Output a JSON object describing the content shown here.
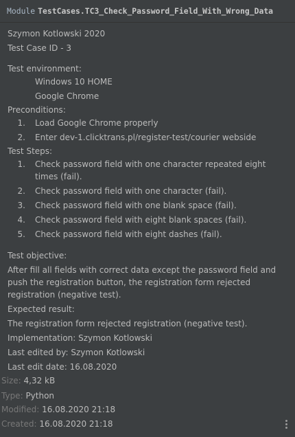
{
  "header": {
    "keyword": "Module",
    "module_name": "TestCases.TC3_Check_Password_Field_With_Wrong_Data"
  },
  "doc": {
    "author_line": "Szymon Kotlowski 2020",
    "test_case_id": "Test Case ID - 3",
    "env_heading": "Test environment:",
    "env_items": [
      "Windows 10 HOME",
      "Google Chrome"
    ],
    "pre_heading": "Preconditions:",
    "pre_items": [
      {
        "num": "1.",
        "text": "Load Google Chrome properly"
      },
      {
        "num": "2.",
        "text": "Enter dev-1.clicktrans.pl/register-test/courier webside"
      }
    ],
    "steps_heading": "Test Steps:",
    "steps": [
      {
        "num": "1.",
        "text": "Check password field with one character repeated eight",
        "text2": "times (fail)."
      },
      {
        "num": "2.",
        "text": "Check password field with one character (fail)."
      },
      {
        "num": "3.",
        "text": "Check password field with one blank space (fail)."
      },
      {
        "num": "4.",
        "text": "Check password field with eight blank spaces (fail)."
      },
      {
        "num": "5.",
        "text": "Check password field with eight dashes (fail)."
      }
    ],
    "objective_heading": "Test objective:",
    "objective_lines": [
      "After fill all fields with correct data except the password field and",
      "push the registration button, the registration form  rejected",
      "registration (negative test)."
    ],
    "expected_heading": "Expected result:",
    "expected_text": "The registration  form  rejected registration (negative test).",
    "implementation": "Implementation: Szymon Kotlowski",
    "last_edited_by": "Last edited by: Szymon Kotlowski",
    "last_edit_date": "Last edit date: 16.08.2020"
  },
  "meta": {
    "size_label": "Size:",
    "size_value": "4,32 kB",
    "type_label": "Type:",
    "type_value": "Python",
    "modified_label": "Modified:",
    "modified_value": "16.08.2020 21:18",
    "created_label": "Created:",
    "created_value": "16.08.2020 21:18"
  },
  "icons": {
    "more": "more-vertical-icon"
  }
}
